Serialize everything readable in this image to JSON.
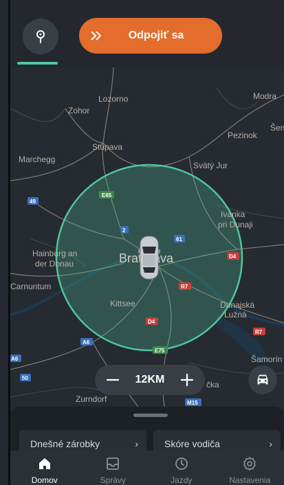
{
  "header": {
    "pin_icon": "map-pin-icon",
    "disconnect_label": "Odpojiť sa",
    "disconnect_icon": "double-chevron-right-icon"
  },
  "map": {
    "places": {
      "lozorno": "Lozorno",
      "modra": "Modra",
      "sen": "Šen",
      "zohor": "Zohor",
      "pezinok": "Pezinok",
      "stupava": "Stupava",
      "marchegg": "Marchegg",
      "svaty_jur": "Svätý Jur",
      "ivanka_1": "Ivanka",
      "ivanka_2": "pri Dunaji",
      "hainburg_1": "Hainburg an",
      "hainburg_2": "der Donau",
      "carnuntum": "Carnuntum",
      "bratislava": "Bratislava",
      "kittsee": "Kittsee",
      "dunajska_1": "Dunajská",
      "dunajska_2": "Lužná",
      "samorin": "Šamorín",
      "zurndorf": "Zurndorf",
      "cka": "čka"
    },
    "shields": {
      "e65": "E65",
      "r49": "49",
      "r2": "2",
      "r61": "61",
      "d4a": "D4",
      "r7a": "R7",
      "d4b": "D4",
      "a6a": "A6",
      "r7b": "R7",
      "a6b": "A6",
      "e75": "E75",
      "r50": "50",
      "m15": "M15"
    },
    "radius_color": "#4fc79a",
    "vehicle_icon": "car-top-view-icon"
  },
  "zoom": {
    "value": "12KM",
    "minus_icon": "minus-icon",
    "plus_icon": "plus-icon"
  },
  "car_button_icon": "car-front-icon",
  "sheet": {
    "cards": [
      {
        "label": "Dnešné zárobky",
        "chevron": "›"
      },
      {
        "label": "Skóre vodiča",
        "chevron": "›"
      }
    ]
  },
  "nav": {
    "items": [
      {
        "label": "Domov",
        "icon": "home-icon",
        "active": true
      },
      {
        "label": "Správy",
        "icon": "inbox-icon",
        "active": false
      },
      {
        "label": "Jazdy",
        "icon": "clock-icon",
        "active": false
      },
      {
        "label": "Nastavenia",
        "icon": "gear-icon",
        "active": false
      }
    ]
  },
  "colors": {
    "accent_orange": "#e36d2c",
    "accent_green": "#4fc79a",
    "background": "#23272d",
    "road_shield_red": "#c2403c",
    "road_shield_blue": "#3b6fb8",
    "road_shield_green": "#3c8a48"
  }
}
